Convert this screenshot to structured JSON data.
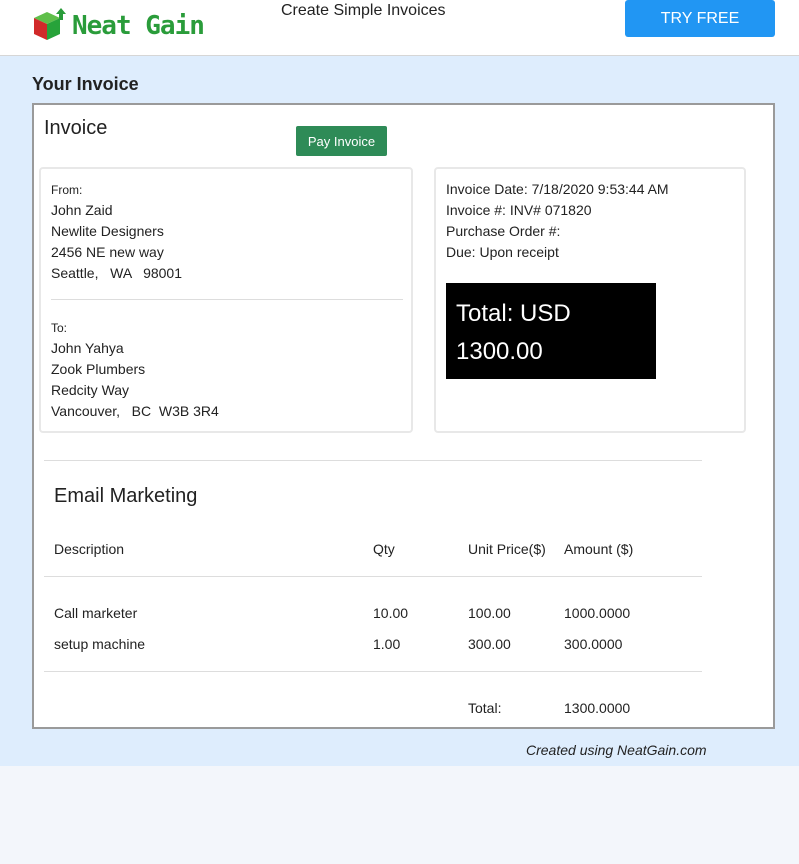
{
  "header": {
    "logo_text": "Neat Gain",
    "tagline": "Create Simple Invoices",
    "try_free_label": "TRY FREE"
  },
  "page": {
    "heading": "Your Invoice",
    "footer_note": "Created using NeatGain.com"
  },
  "invoice": {
    "title": "Invoice",
    "pay_label": "Pay Invoice",
    "from": {
      "label": "From:",
      "name": "John Zaid",
      "company": "Newlite Designers",
      "street": "2456 NE new way",
      "city_line": "Seattle,   WA   98001"
    },
    "to": {
      "label": "To:",
      "name": "John Yahya",
      "company": "Zook Plumbers",
      "street": "Redcity Way",
      "city_line": "Vancouver,   BC  W3B 3R4"
    },
    "meta": {
      "date": "Invoice Date: 7/18/2020 9:53:44 AM",
      "number": "Invoice #: INV# 071820",
      "po": "Purchase Order #:",
      "due": "Due: Upon receipt"
    },
    "total_box": {
      "line1": "Total: USD",
      "line2": "1300.00"
    },
    "section_title": "Email Marketing",
    "columns": [
      "Description",
      "Qty",
      "Unit Price($)",
      "Amount ($)"
    ],
    "rows": [
      [
        "Call marketer",
        "10.00",
        "100.00",
        "1000.0000"
      ],
      [
        "setup machine",
        "1.00",
        "300.00",
        "300.0000"
      ]
    ],
    "total_label": "Total:",
    "total_value": "1300.0000"
  },
  "colors": {
    "brand_green": "#2a9c3a",
    "try_button": "#2196f3",
    "pay_button": "#2e8b57",
    "band": "#deedfd"
  },
  "icons": {
    "logo": "cube-arrow-icon"
  }
}
